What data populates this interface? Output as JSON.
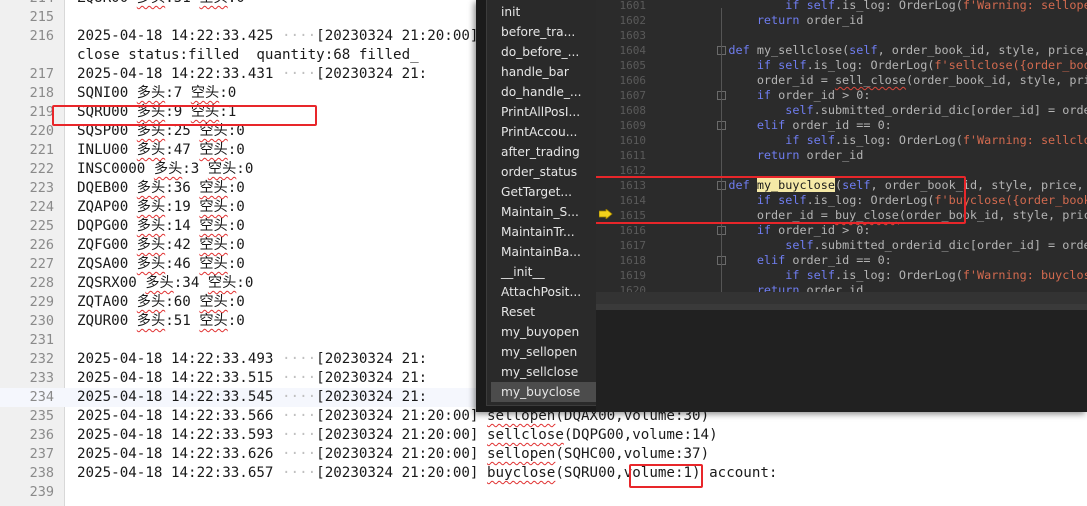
{
  "log_editor": {
    "lines": [
      {
        "num": "214",
        "text": "ZQUR00 多头:51 空头:0"
      },
      {
        "num": "215",
        "text": ""
      },
      {
        "num": "216",
        "text": "2025-04-18 14:22:33.425 ····[20230324 21:20:00]"
      },
      {
        "num": "",
        "text": "close status:filled  quantity:68 filled_"
      },
      {
        "num": "217",
        "text": "2025-04-18 14:22:33.431 ····[20230324 21:"
      },
      {
        "num": "218",
        "text": "SQNI00 多头:7 空头:0"
      },
      {
        "num": "219",
        "text": "SQRU00 多头:9 空头:1"
      },
      {
        "num": "220",
        "text": "SQSP00 多头:25 空头:0"
      },
      {
        "num": "221",
        "text": "INLU00 多头:47 空头:0"
      },
      {
        "num": "222",
        "text": "INSC0000 多头:3 空头:0"
      },
      {
        "num": "223",
        "text": "DQEB00 多头:36 空头:0"
      },
      {
        "num": "224",
        "text": "ZQAP00 多头:19 空头:0"
      },
      {
        "num": "225",
        "text": "DQPG00 多头:14 空头:0"
      },
      {
        "num": "226",
        "text": "ZQFG00 多头:42 空头:0"
      },
      {
        "num": "227",
        "text": "ZQSA00 多头:46 空头:0"
      },
      {
        "num": "228",
        "text": "ZQSRX00 多头:34 空头:0"
      },
      {
        "num": "229",
        "text": "ZQTA00 多头:60 空头:0"
      },
      {
        "num": "230",
        "text": "ZQUR00 多头:51 空头:0"
      },
      {
        "num": "231",
        "text": ""
      },
      {
        "num": "232",
        "text": "2025-04-18 14:22:33.493 ····[20230324 21:"
      },
      {
        "num": "233",
        "text": "2025-04-18 14:22:33.515 ····[20230324 21:"
      },
      {
        "num": "234",
        "text": "2025-04-18 14:22:33.545 ····[20230324 21:"
      },
      {
        "num": "235",
        "text": "2025-04-18 14:22:33.566 ····[20230324 21:20:00] sellopen(DQAX00,volume:30)"
      },
      {
        "num": "236",
        "text": "2025-04-18 14:22:33.593 ····[20230324 21:20:00] sellclose(DQPG00,volume:14)"
      },
      {
        "num": "237",
        "text": "2025-04-18 14:22:33.626 ····[20230324 21:20:00] sellopen(SQHC00,volume:37)"
      },
      {
        "num": "238",
        "text": "2025-04-18 14:22:33.657 ····[20230324 21:20:00] buyclose(SQRU00,volume:1) account:"
      },
      {
        "num": "239",
        "text": ""
      }
    ]
  },
  "outline": {
    "items": [
      "init",
      "before_tra...",
      "do_before_...",
      "handle_bar",
      "do_handle_...",
      "PrintAllPosI...",
      "PrintAccou...",
      "after_trading",
      "order_status",
      "GetTarget...",
      "Maintain_S...",
      "MaintainTr...",
      "MaintainBa...",
      "__init__",
      "AttachPosit...",
      "Reset",
      "my_buyopen",
      "my_sellopen",
      "my_sellclose",
      "my_buyclose"
    ],
    "selected": "my_buyclose"
  },
  "code_view": {
    "lines": [
      {
        "num": "1601",
        "code": "            if self.is_log: OrderLog(f'Warning: sellopen({or"
      },
      {
        "num": "1602",
        "code": "        return order_id"
      },
      {
        "num": "1603",
        "code": ""
      },
      {
        "num": "1604",
        "code": "    def my_sellclose(self, order_book_id, style, price, volu"
      },
      {
        "num": "1605",
        "code": "        if self.is_log: OrderLog(f'sellclose({order_book_id}"
      },
      {
        "num": "1606",
        "code": "        order_id = sell_close(order_book_id, style, price, v"
      },
      {
        "num": "1607",
        "code": "        if order_id > 0:"
      },
      {
        "num": "1608",
        "code": "            self.submitted_orderid_dic[order_id] = order_boo"
      },
      {
        "num": "1609",
        "code": "        elif order_id == 0:"
      },
      {
        "num": "1610",
        "code": "            if self.is_log: OrderLog(f'Warning: sellclose({o"
      },
      {
        "num": "1611",
        "code": "        return order_id"
      },
      {
        "num": "1612",
        "code": ""
      },
      {
        "num": "1613",
        "code": "    def my_buyclose(self, order_book_id, style, price, volum"
      },
      {
        "num": "1614",
        "code": "        if self.is_log: OrderLog(f'buyclose({order_book_id},"
      },
      {
        "num": "1615",
        "code": "        order_id = buy_close(order_book_id, style, price, vo"
      },
      {
        "num": "1616",
        "code": "        if order_id > 0:"
      },
      {
        "num": "1617",
        "code": "            self.submitted_orderid_dic[order_id] = order_boo"
      },
      {
        "num": "1618",
        "code": "        elif order_id == 0:"
      },
      {
        "num": "1619",
        "code": "            if self.is_log: OrderLog(f'Warning: buyclose({or"
      },
      {
        "num": "1620",
        "code": "        return order_id"
      }
    ]
  },
  "colors": {
    "highlight_box": "#e8262a",
    "ide_background": "#2b2b2b",
    "keyword": "#6f7df0",
    "string": "#d26a4f"
  }
}
